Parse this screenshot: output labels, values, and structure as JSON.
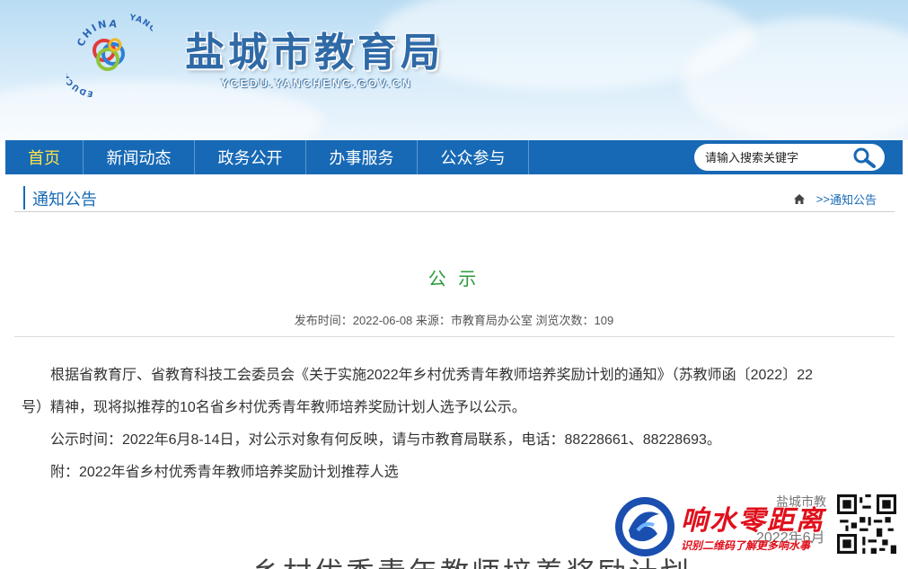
{
  "header": {
    "site_title": "盐城市教育局",
    "site_domain": "YCEDU.YANCHENG.GOV.CN",
    "logo_text_top": "CHINA",
    "logo_text_left": "EDUCATION",
    "logo_text_right": "YANCHENG"
  },
  "nav": {
    "items": [
      {
        "label": "首页"
      },
      {
        "label": "新闻动态"
      },
      {
        "label": "政务公开"
      },
      {
        "label": "办事服务"
      },
      {
        "label": "公众参与"
      }
    ],
    "search_placeholder": "请输入搜索关键字",
    "active_color": "#ffe34a",
    "bar_color": "#1769b5"
  },
  "breadcrumb": {
    "section_title": "通知公告",
    "trail_sep": ">>",
    "trail_current": "通知公告",
    "home_icon": "home-icon"
  },
  "article": {
    "title": "公 示",
    "meta": "发布时间：2022-06-08 来源：市教育局办公室 浏览次数：109",
    "paragraphs": [
      "根据省教育厅、省教育科技工会委员会《关于实施2022年乡村优秀青年教师培养奖励计划的通知》（苏教师函〔2022〕22号）精神，现将拟推荐的10名省乡村优秀青年教师培养奖励计划人选予以公示。",
      "公示时间：2022年6月8-14日，对公示对象有何反映，请与市教育局联系，电话：88228661、88228693。",
      "附：2022年省乡村优秀青年教师培养奖励计划推荐人选"
    ],
    "signature_partial": "盐城市教",
    "date_partial": "2022年6月",
    "bottom_heading_partial": "乡村优秀青年教师培养奖励计划"
  },
  "watermark": {
    "title": "响水零距离",
    "subtitle": "识别二维码了解更多响水事"
  }
}
